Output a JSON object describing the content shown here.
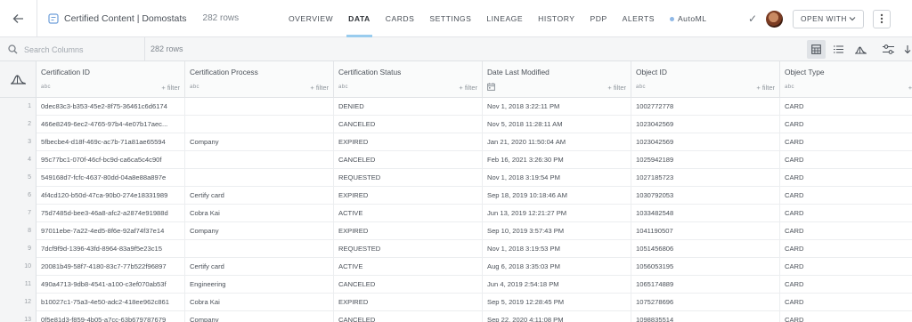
{
  "header": {
    "title": "Certified Content | Domostats",
    "row_count": "282 rows",
    "tabs": [
      "OVERVIEW",
      "DATA",
      "CARDS",
      "SETTINGS",
      "LINEAGE",
      "HISTORY",
      "PDP",
      "ALERTS",
      "AutoML"
    ],
    "active_tab": "DATA",
    "open_with_label": "OPEN WITH"
  },
  "toolbar": {
    "search_placeholder": "Search Columns",
    "row_count": "282 rows"
  },
  "columns": [
    {
      "name": "Certification ID",
      "type": "abc",
      "filter": "+ filter"
    },
    {
      "name": "Certification Process",
      "type": "abc",
      "filter": "+ filter"
    },
    {
      "name": "Certification Status",
      "type": "abc",
      "filter": "+ filter"
    },
    {
      "name": "Date Last Modified",
      "type": "date",
      "filter": "+ filter"
    },
    {
      "name": "Object ID",
      "type": "abc",
      "filter": "+ filter"
    },
    {
      "name": "Object Type",
      "type": "abc",
      "filter": "+ fi"
    }
  ],
  "rows": [
    {
      "n": "1",
      "cells": [
        "0dec83c3-b353-45e2-8f75-36461c6d6174",
        "",
        "DENIED",
        "Nov 1, 2018 3:22:11 PM",
        "1002772778",
        "CARD"
      ]
    },
    {
      "n": "2",
      "cells": [
        "466e8249-6ec2-4765-97b4-4e07b17aec...",
        "",
        "CANCELED",
        "Nov 5, 2018 11:28:11 AM",
        "1023042569",
        "CARD"
      ]
    },
    {
      "n": "3",
      "cells": [
        "5fbecbe4-d18f-469c-ac7b-71a81ae65594",
        "Company",
        "EXPIRED",
        "Jan 21, 2020 11:50:04 AM",
        "1023042569",
        "CARD"
      ]
    },
    {
      "n": "4",
      "cells": [
        "95c77bc1-070f-46cf-bc9d-ca6ca5c4c90f",
        "",
        "CANCELED",
        "Feb 16, 2021 3:26:30 PM",
        "1025942189",
        "CARD"
      ]
    },
    {
      "n": "5",
      "cells": [
        "549168d7-fcfc-4637-80dd-04a8e88a897e",
        "",
        "REQUESTED",
        "Nov 1, 2018 3:19:54 PM",
        "1027185723",
        "CARD"
      ]
    },
    {
      "n": "6",
      "cells": [
        "4f4cd120-b50d-47ca-90b0-274e18331989",
        "Certify card",
        "EXPIRED",
        "Sep 18, 2019 10:18:46 AM",
        "1030792053",
        "CARD"
      ]
    },
    {
      "n": "7",
      "cells": [
        "75d7485d-bee3-46a8-afc2-a2874e91988d",
        "Cobra Kai",
        "ACTIVE",
        "Jun 13, 2019 12:21:27 PM",
        "1033482548",
        "CARD"
      ]
    },
    {
      "n": "8",
      "cells": [
        "97011ebe-7a22-4ed5-8f6e-92af74f37e14",
        "Company",
        "EXPIRED",
        "Sep 10, 2019 3:57:43 PM",
        "1041190507",
        "CARD"
      ]
    },
    {
      "n": "9",
      "cells": [
        "7dcf9f9d-1396-43fd-8964-83a9f5e23c15",
        "",
        "REQUESTED",
        "Nov 1, 2018 3:19:53 PM",
        "1051456806",
        "CARD"
      ]
    },
    {
      "n": "10",
      "cells": [
        "20081b49-58f7-4180-83c7-77b522f96897",
        "Certify card",
        "ACTIVE",
        "Aug 6, 2018 3:35:03 PM",
        "1056053195",
        "CARD"
      ]
    },
    {
      "n": "11",
      "cells": [
        "490a4713-9db8-4541-a100-c3ef070ab53f",
        "Engineering",
        "CANCELED",
        "Jun 4, 2019 2:54:18 PM",
        "1065174889",
        "CARD"
      ]
    },
    {
      "n": "12",
      "cells": [
        "b10027c1-75a3-4e50-adc2-418ee962c861",
        "Cobra Kai",
        "EXPIRED",
        "Sep 5, 2019 12:28:45 PM",
        "1075278696",
        "CARD"
      ]
    },
    {
      "n": "13",
      "cells": [
        "0f5e81d3-f859-4b05-a7cc-63b679787679",
        "Company",
        "CANCELED",
        "Sep 22, 2020 4:11:08 PM",
        "1098835514",
        "CARD"
      ]
    }
  ]
}
